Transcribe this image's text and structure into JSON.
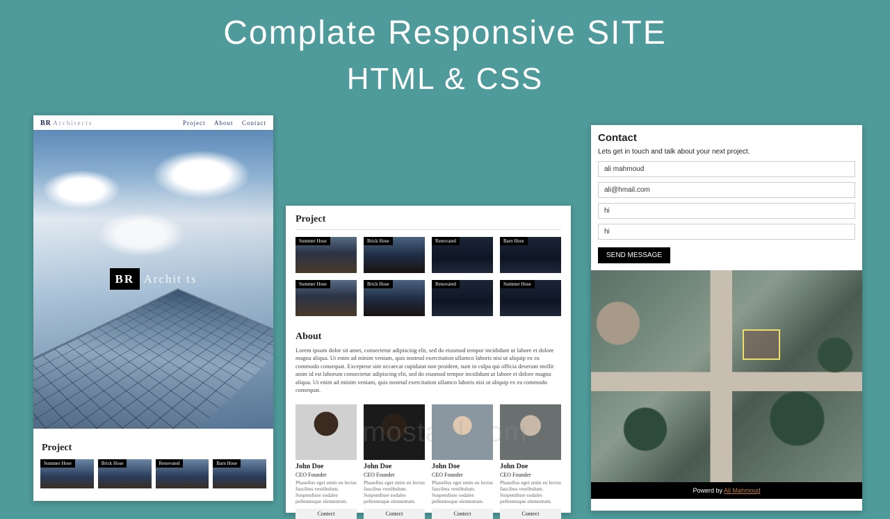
{
  "headline": {
    "line1": "Complate Responsive SITE",
    "line2": "HTML & CSS"
  },
  "watermark": "mostaql.com",
  "panel_a": {
    "brand_bold": "BR",
    "brand_light": "Architects",
    "nav": [
      "Project",
      "About",
      "Contact"
    ],
    "hero_bold": "BR",
    "hero_light": "Archit   ts",
    "project_heading": "Project",
    "cards": [
      "Summer Hose",
      "Brick Hose",
      "Renovated",
      "Barn Hose"
    ]
  },
  "panel_b": {
    "project_heading": "Project",
    "row1": [
      "Summer Hose",
      "Brick Hose",
      "Renovated",
      "Barn Hose"
    ],
    "row2": [
      "Summer Hose",
      "Brick Hose",
      "Renovated",
      "Summer Hose"
    ],
    "about_heading": "About",
    "about_text": "Lorem ipsum dolor sit amet, consectetur adipiscing elit, sed do eiusmod tempor incididunt ut labore et dolore magna aliqua. Ut enim ad minim veniam, quis nostrud exercitation ullamco laboris nisi ut aliquip ex ea commodo consequat. Excepteur sint occaecat cupidatat non proident, sunt in culpa qui officia deserunt mollit anim id est laborum consectetur adipiscing elit, sed do eiusmod tempor incididunt ut labore et dolore magna aliqua. Ut enim ad minim veniam, quis nostrud exercitation ullamco laboris nisi ut aliquip ex ea commodo consequat.",
    "team": [
      {
        "name": "John Doe",
        "role": "CEO Founder",
        "bio": "Phasellus eget enim eu lectus faucibus vestibulum. Suspendisse sodales pellentesque elementum.",
        "btn": "Contect"
      },
      {
        "name": "John Doe",
        "role": "CEO Founder",
        "bio": "Phasellus eget enim eu lectus faucibus vestibulum. Suspendisse sodales pellentesque elementum.",
        "btn": "Contect"
      },
      {
        "name": "John Doe",
        "role": "CEO Founder",
        "bio": "Phasellus eget enim eu lectus faucibus vestibulum. Suspendisse sodales pellentesque elementum.",
        "btn": "Contect"
      },
      {
        "name": "John Doe",
        "role": "CEO Founder",
        "bio": "Phasellus eget enim eu lectus faucibus vestibulum. Suspendisse sodales pellentesque elementum.",
        "btn": "Contect"
      }
    ]
  },
  "panel_c": {
    "heading": "Contact",
    "lead": "Lets get in touch and talk about your next project.",
    "fields": [
      "ali mahmoud",
      "ali@hmail.com",
      "hi",
      "hi"
    ],
    "send": "SEND MESSAGE",
    "footer_prefix": "Powerd by ",
    "footer_link": "Ali Mahmoud"
  }
}
